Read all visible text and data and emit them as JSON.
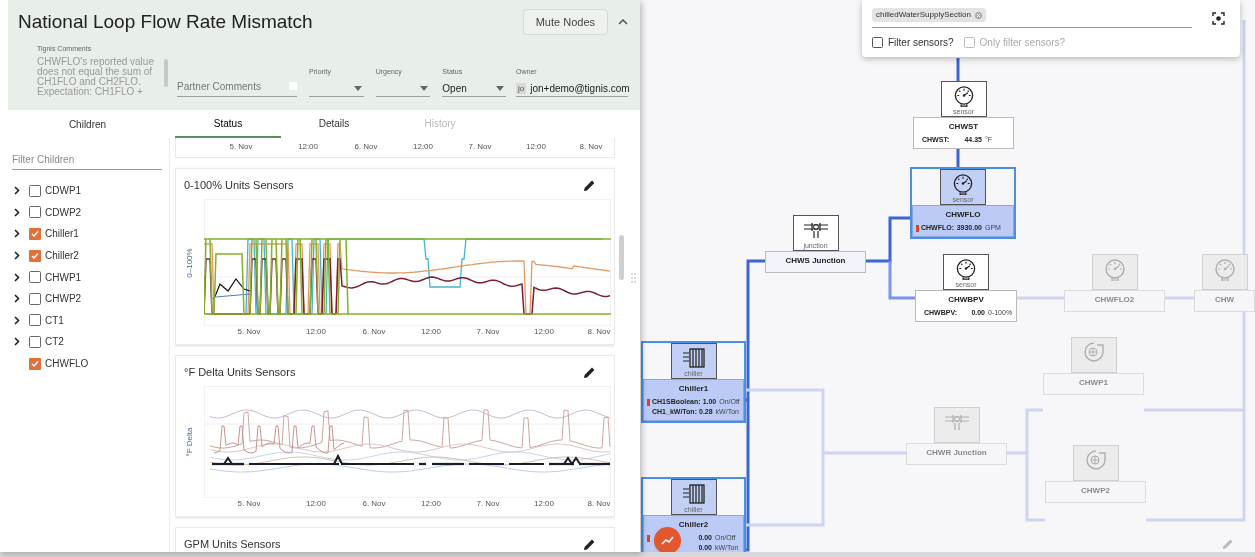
{
  "panel": {
    "title": "National Loop Flow Rate Mismatch",
    "mute_button": "Mute Nodes",
    "tignis_comments": {
      "label": "Tignis Comments",
      "value": "CHWFLO's reported value does not equal the sum of CH1FLO and CH2FLO. Expectation: CH1FLO +"
    },
    "partner_comments": {
      "placeholder": "Partner Comments"
    },
    "selects": [
      {
        "label": "Priority"
      },
      {
        "label": "Urgency"
      },
      {
        "label": "Status",
        "value": "Open"
      }
    ],
    "owner": {
      "label": "Owner",
      "avatar": "jo",
      "value": "jon+demo@tignis.com"
    },
    "children_heading": "Children",
    "tabs": [
      {
        "label": "Status",
        "selected": true,
        "disabled": false
      },
      {
        "label": "Details",
        "selected": false,
        "disabled": false
      },
      {
        "label": "History",
        "selected": false,
        "disabled": true
      }
    ],
    "children_filter": {
      "placeholder": "Filter Children"
    },
    "children": [
      {
        "label": "CDWP1",
        "expandable": true,
        "checked": false
      },
      {
        "label": "CDWP2",
        "expandable": true,
        "checked": false
      },
      {
        "label": "Chiller1",
        "expandable": true,
        "checked": true
      },
      {
        "label": "Chiller2",
        "expandable": true,
        "checked": true
      },
      {
        "label": "CHWP1",
        "expandable": true,
        "checked": false
      },
      {
        "label": "CHWP2",
        "expandable": true,
        "checked": false
      },
      {
        "label": "CT1",
        "expandable": true,
        "checked": false
      },
      {
        "label": "CT2",
        "expandable": true,
        "checked": false
      },
      {
        "label": "CHWFLO",
        "expandable": false,
        "checked": true
      }
    ],
    "cards": [
      {
        "kind": "axis",
        "x_ticks": [
          "5. Nov",
          "12:00",
          "6. Nov",
          "12:00",
          "7. Nov",
          "12:00",
          "8. Nov"
        ]
      },
      {
        "kind": "chart",
        "title": "0-100% Units Sensors",
        "ylabel": "0–100%",
        "x_ticks": [
          "5. Nov",
          "12:00",
          "6. Nov",
          "12:00",
          "7. Nov",
          "12:00",
          "8. Nov"
        ]
      },
      {
        "kind": "chart",
        "title": "°F Delta Units Sensors",
        "ylabel": "°F Delta",
        "x_ticks": [
          "5. Nov",
          "12:00",
          "6. Nov",
          "12:00",
          "7. Nov",
          "12:00",
          "8. Nov"
        ]
      },
      {
        "kind": "heading",
        "title": "GPM Units Sensors"
      }
    ]
  },
  "diagram": {
    "filter": {
      "chips": [
        "chilledWaterSupplySection"
      ],
      "options": [
        {
          "label": "Filter sensors?",
          "checked": false,
          "disabled": false
        },
        {
          "label": "Only filter sensors?",
          "checked": false,
          "disabled": true
        }
      ]
    },
    "nodes": [
      {
        "kind": "sensor",
        "type_label": "sensor",
        "name": "CHWST",
        "selected": false,
        "dimmed": false,
        "readings": [
          {
            "label": "CHWST:",
            "value": "44.35",
            "unit": "°F",
            "alarm": false
          }
        ]
      },
      {
        "kind": "sensor",
        "type_label": "sensor",
        "name": "CHWFLO",
        "selected": true,
        "dimmed": false,
        "readings": [
          {
            "label": "CHWFLO:",
            "value": "3930.00",
            "unit": "GPM",
            "alarm": true
          }
        ]
      },
      {
        "kind": "junction",
        "type_label": "junction",
        "name": "CHWS Junction",
        "selected": false,
        "dimmed": false
      },
      {
        "kind": "sensor",
        "type_label": "sensor",
        "name": "CHWBPV",
        "selected": false,
        "dimmed": false,
        "readings": [
          {
            "label": "CHWBPV:",
            "value": "0.00",
            "unit": "0-100%",
            "alarm": false
          }
        ]
      },
      {
        "kind": "sensor",
        "name": "CHWFLO2",
        "selected": false,
        "dimmed": true
      },
      {
        "kind": "sensor",
        "name": "CHW",
        "selected": false,
        "dimmed": true
      },
      {
        "kind": "chiller",
        "type_label": "chiller",
        "name": "Chiller1",
        "selected": true,
        "dimmed": false,
        "readings": [
          {
            "label": "CH1SBoolean:",
            "value": "1.00",
            "unit": "On/Off",
            "alarm": true
          },
          {
            "label": "CH1_kW/Ton:",
            "value": "0.28",
            "unit": "kW/Ton",
            "alarm": false
          }
        ]
      },
      {
        "kind": "chiller",
        "type_label": "chiller",
        "name": "Chiller2",
        "selected": true,
        "dimmed": false,
        "readings": [
          {
            "value": "0.00",
            "unit": "On/Off",
            "alarm": true
          },
          {
            "value": "0.00",
            "unit": "kW/Ton",
            "alarm": false
          }
        ]
      },
      {
        "kind": "junction",
        "name": "CHWR Junction",
        "selected": false,
        "dimmed": true
      },
      {
        "kind": "pump",
        "name": "CHWP1",
        "selected": false,
        "dimmed": true
      },
      {
        "kind": "pump",
        "name": "CHWP2",
        "selected": false,
        "dimmed": true
      }
    ]
  }
}
